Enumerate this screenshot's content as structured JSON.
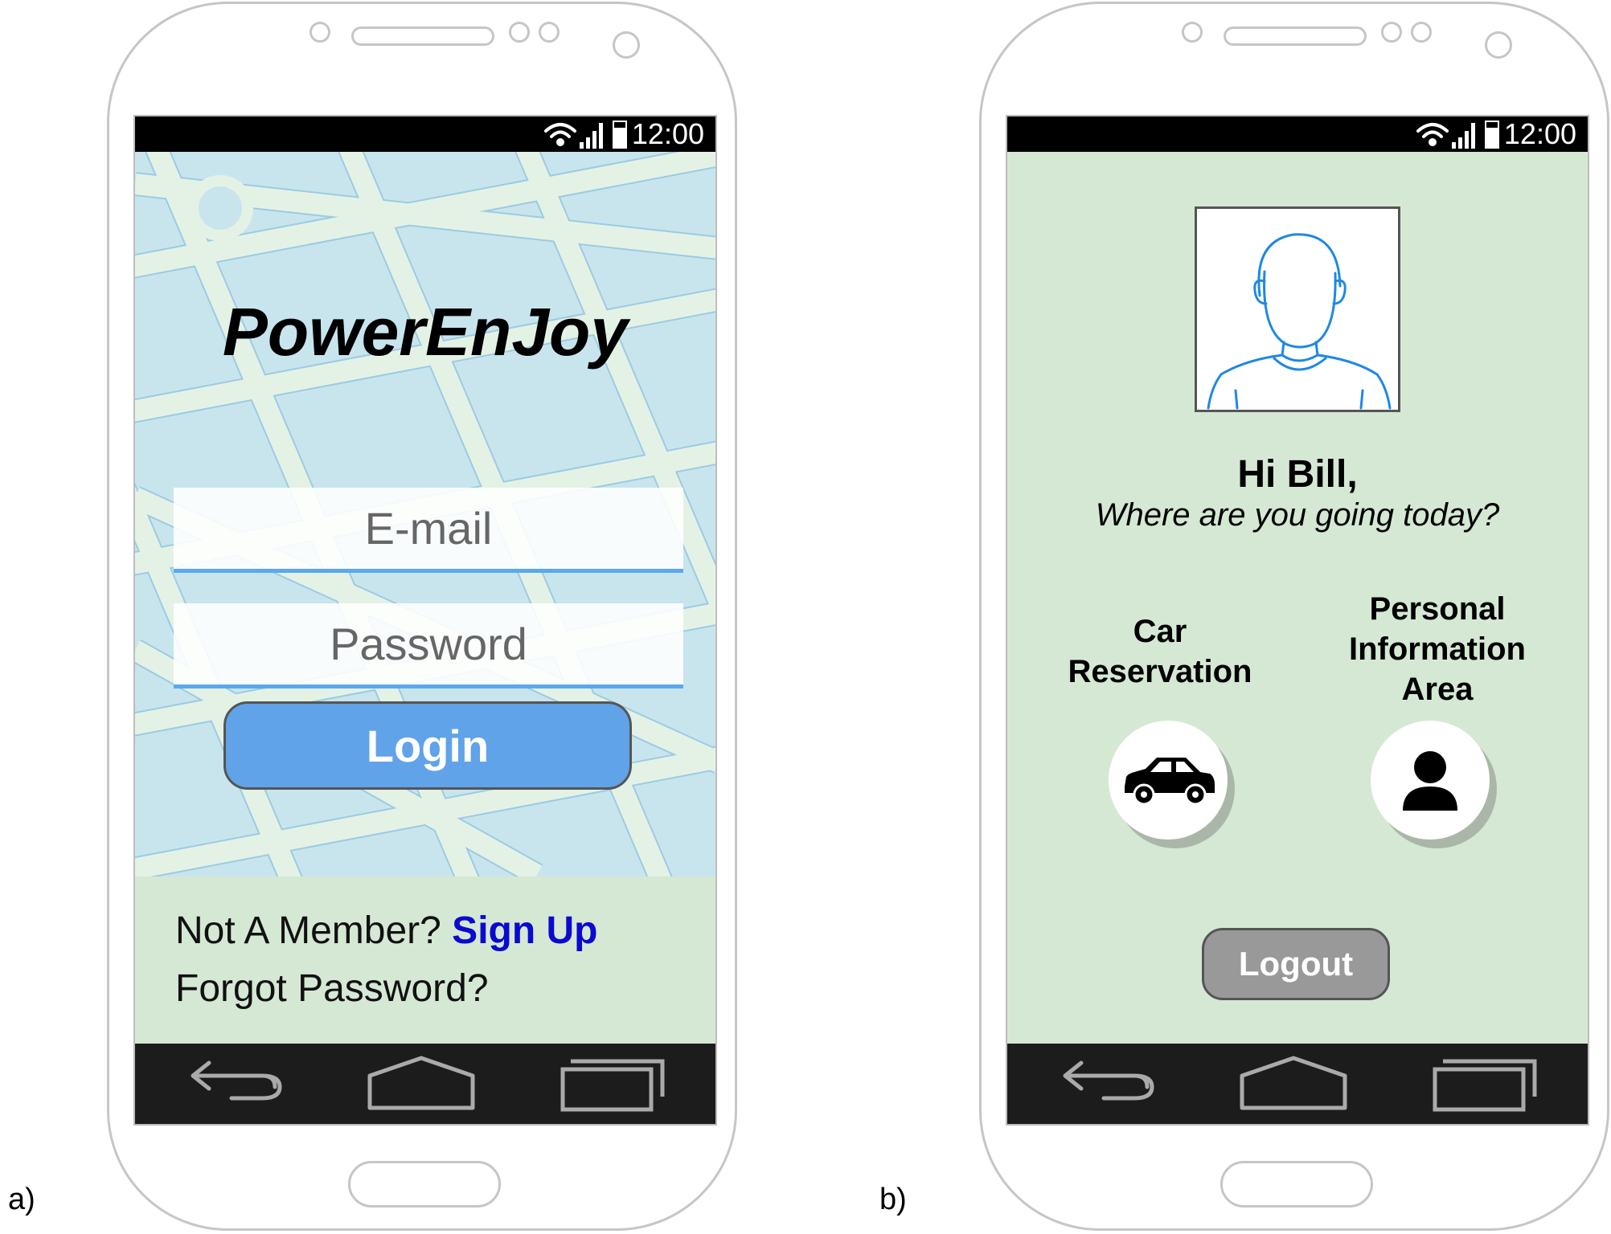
{
  "panels": [
    {
      "label": "a)",
      "status_bar": {
        "time": "12:00"
      },
      "app_title": "PowerEnJoy",
      "email_field": {
        "placeholder": "E-mail"
      },
      "password_field": {
        "placeholder": "Password"
      },
      "login_button": {
        "label": "Login"
      },
      "footer": {
        "member_prompt": "Not A Member?",
        "signup_link": "Sign Up",
        "forgot_password": "Forgot Password?"
      },
      "nav_bar": {
        "icons": [
          "back-icon",
          "home-icon",
          "recent-apps-icon"
        ]
      }
    },
    {
      "label": "b)",
      "status_bar": {
        "time": "12:00"
      },
      "greeting": {
        "name": "Hi Bill,",
        "question": "Where are you going today?"
      },
      "options": {
        "car_reservation": {
          "label_line1": "Car",
          "label_line2": "Reservation",
          "icon": "car-icon"
        },
        "personal_info": {
          "label_line1": "Personal",
          "label_line2": "Information",
          "label_line3": "Area",
          "icon": "person-icon"
        }
      },
      "logout_button": {
        "label": "Logout"
      },
      "nav_bar": {
        "icons": [
          "back-icon",
          "home-icon",
          "recent-apps-icon"
        ]
      }
    }
  ],
  "colors": {
    "map_water": "#c8e5ee",
    "map_roads": "#e4f2e6",
    "footer_bg": "#d5e8d4",
    "login_button": "#60a3e8",
    "signup_link": "#0a0ad0",
    "logout_button": "#999999",
    "avatar_stroke": "#1e88e5"
  }
}
